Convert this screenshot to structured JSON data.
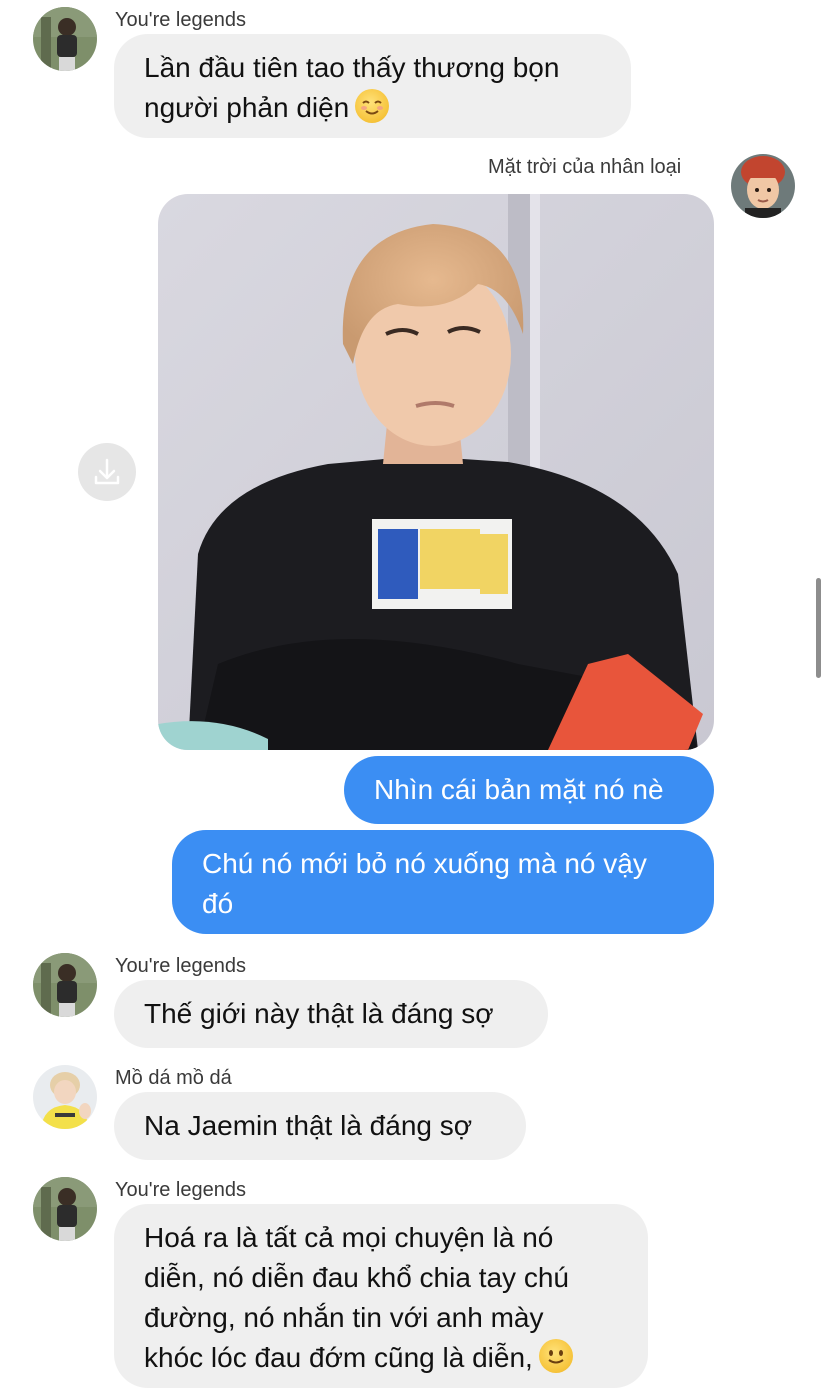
{
  "messages": [
    {
      "sender": "You're legends",
      "text_lines": [
        "Lần đầu tiên tao thấy thương bọn",
        "người phản diện"
      ],
      "emoji": "relieved-smile-emoji"
    },
    {
      "sender": "Mặt trời của nhân loại",
      "attachment": "photo"
    },
    {
      "text": "Nhìn cái bản mặt nó nè"
    },
    {
      "text_lines": [
        "Chú nó mới bỏ nó xuống mà nó vậy",
        "đó"
      ]
    },
    {
      "sender": "You're legends",
      "text": "Thế giới này thật là đáng sợ"
    },
    {
      "sender": "Mồ dá mồ dá",
      "text": "Na Jaemin thật là đáng sợ"
    },
    {
      "sender": "You're legends",
      "text_lines": [
        "Hoá ra là tất cả mọi chuyện là nó",
        "diễn, nó diễn đau khổ chia tay chú",
        "đường, nó nhắn tin với anh mày",
        "khóc lóc đau đớm cũng là diễn,"
      ],
      "emoji": "slight-smile-emoji"
    }
  ],
  "icons": {
    "download": "download-icon"
  },
  "colors": {
    "outgoing_bubble": "#3b8ef3",
    "incoming_bubble": "#efefef"
  }
}
